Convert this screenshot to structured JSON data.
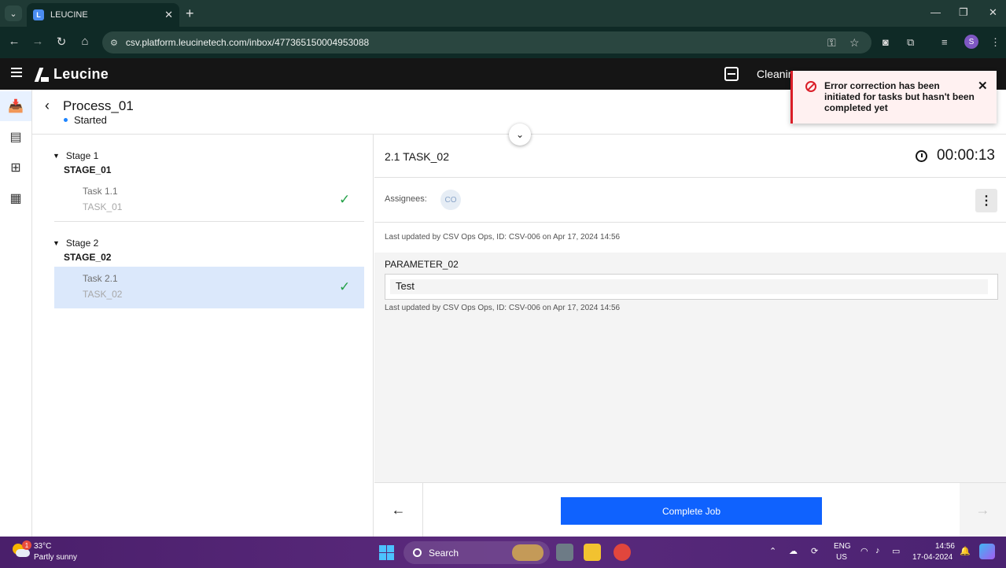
{
  "browser": {
    "tab_title": "LEUCINE",
    "url": "csv.platform.leucinetech.com/inbox/477365150004953088",
    "profile_initial": "S"
  },
  "app": {
    "brand": "Leucine",
    "facility": "Cleanin"
  },
  "job": {
    "name": "Process_01",
    "state": "Started"
  },
  "stages": [
    {
      "label": "Stage 1",
      "name": "STAGE_01",
      "tasks": [
        {
          "label": "Task 1.1",
          "name": "TASK_01"
        }
      ]
    },
    {
      "label": "Stage 2",
      "name": "STAGE_02",
      "tasks": [
        {
          "label": "Task 2.1",
          "name": "TASK_02"
        }
      ]
    }
  ],
  "task": {
    "title": "2.1 TASK_02",
    "timer": "00:00:13",
    "assignees_label": "Assignees:",
    "assignee_initials": "CO",
    "last_updated": "Last updated by CSV Ops Ops, ID: CSV-006 on Apr 17, 2024 14:56",
    "parameter": {
      "label": "PARAMETER_02",
      "value": "Test",
      "last_updated": "Last updated by CSV Ops Ops, ID: CSV-006 on Apr 17, 2024 14:56"
    }
  },
  "footer": {
    "complete_label": "Complete Job"
  },
  "toast": {
    "message": "Error correction has been initiated for tasks but hasn't been completed yet",
    "color": "#da1e28"
  },
  "taskbar": {
    "temperature": "33°C",
    "condition": "Partly sunny",
    "weather_badge": "1",
    "search_label": "Search",
    "lang": "ENG",
    "region": "US",
    "time": "14:56",
    "date": "17-04-2024"
  },
  "colors": {
    "primary": "#0f62fe",
    "success": "#24a148",
    "selected_row": "#dbe8fb"
  }
}
